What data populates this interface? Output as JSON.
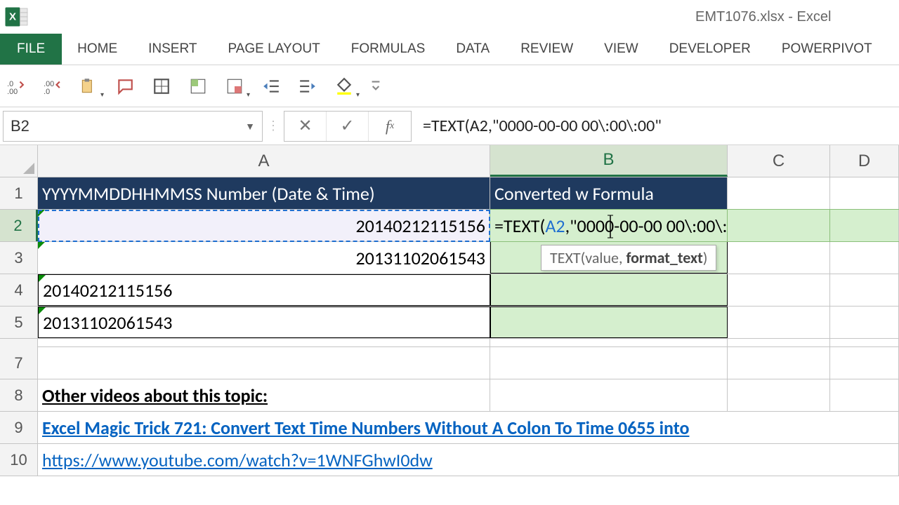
{
  "app": {
    "title": "EMT1076.xlsx - Excel"
  },
  "ribbon": {
    "file": "FILE",
    "tabs": [
      "HOME",
      "INSERT",
      "PAGE LAYOUT",
      "FORMULAS",
      "DATA",
      "REVIEW",
      "VIEW",
      "DEVELOPER",
      "POWERPIVOT"
    ]
  },
  "name_box": "B2",
  "formula_bar": "=TEXT(A2,\"0000-00-00 00\\:00\\:00\"",
  "columns": [
    "A",
    "B",
    "C",
    "D"
  ],
  "headers": {
    "A": "YYYYMMDDHHMMSS Number (Date & Time)",
    "B": "Converted w Formula"
  },
  "cells": {
    "A2": "20140212115156",
    "A3": "20131102061543",
    "A4": "20140212115156",
    "A5": "20131102061543",
    "A8": "Other videos about this topic:",
    "A9": "Excel Magic Trick 721: Convert Text Time Numbers Without A Colon To Time 0655 into",
    "A10": "https://www.youtube.com/watch?v=1WNFGhwI0dw"
  },
  "b2_formula": {
    "prefix": "=TEXT(",
    "ref": "A2",
    "suffix": ",\"0000-00-00 00\\:00\\:00\""
  },
  "tooltip": {
    "fn": "TEXT",
    "sig": "(value, ",
    "bold_arg": "format_text",
    "close": ")"
  },
  "row_labels": [
    "1",
    "2",
    "3",
    "4",
    "5",
    "",
    "7",
    "8",
    "9",
    "10"
  ]
}
